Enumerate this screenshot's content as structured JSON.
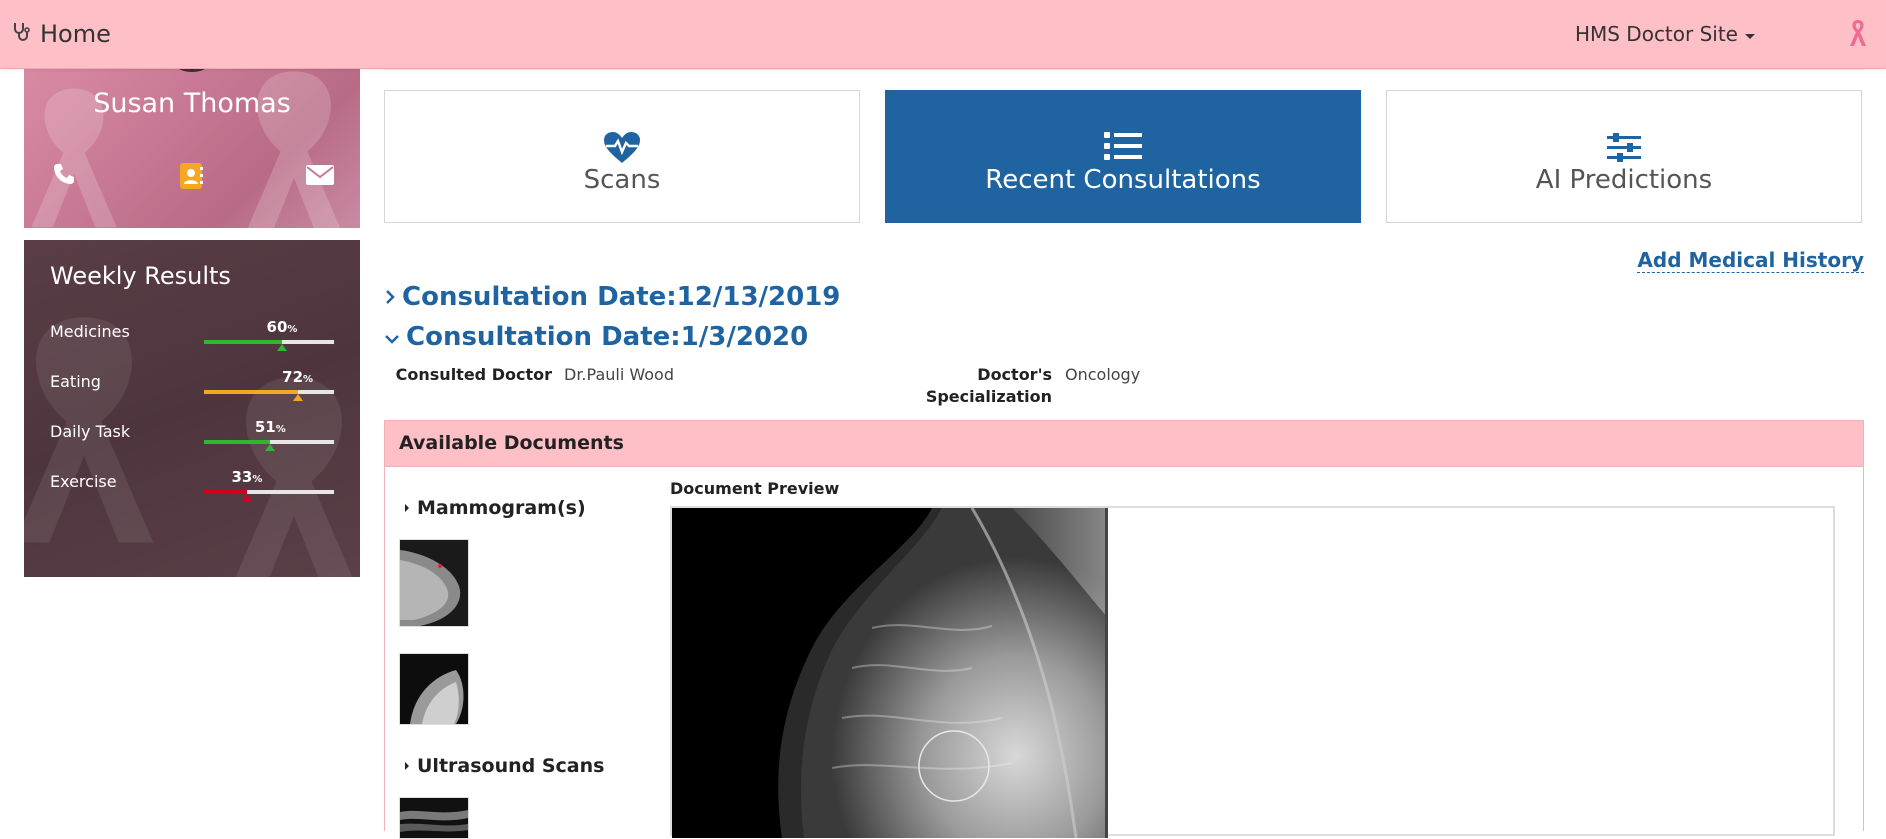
{
  "nav": {
    "home_label": "Home",
    "site_menu_label": "HMS Doctor Site",
    "icons": [
      "stethoscope-icon",
      "caret-down-icon",
      "pink-ribbon-icon"
    ]
  },
  "profile": {
    "name": "Susan Thomas",
    "icons": [
      "phone-icon",
      "contact-card-icon",
      "envelope-icon"
    ]
  },
  "weekly": {
    "title": "Weekly Results",
    "items": [
      {
        "label": "Medicines",
        "value": "60",
        "percent": 60,
        "color": "#2eb82e"
      },
      {
        "label": "Eating",
        "value": "72",
        "percent": 72,
        "color": "#f5a623"
      },
      {
        "label": "Daily Task",
        "value": "51",
        "percent": 51,
        "color": "#2eb82e"
      },
      {
        "label": "Exercise",
        "value": "33",
        "percent": 33,
        "color": "#d0021b"
      }
    ],
    "unit": "%"
  },
  "tabs": [
    {
      "label": "Scans",
      "icon": "heart-pulse-icon",
      "active": false
    },
    {
      "label": "Recent Consultations",
      "icon": "list-icon",
      "active": true
    },
    {
      "label": "AI Predictions",
      "icon": "sliders-icon",
      "active": false
    }
  ],
  "add_history_label": "Add Medical History",
  "consultations": [
    {
      "label": "Consultation Date:12/13/2019",
      "expanded": false
    },
    {
      "label": "Consultation Date:1/3/2020",
      "expanded": true
    }
  ],
  "details": {
    "doctor_label": "Consulted Doctor",
    "doctor_value": "Dr.Pauli Wood",
    "spec_label_line1": "Doctor's",
    "spec_label_line2": "Specialization",
    "spec_value": "Oncology"
  },
  "documents": {
    "title": "Available Documents",
    "groups": [
      "Mammogram(s)",
      "Ultrasound Scans"
    ],
    "preview_label": "Document Preview"
  },
  "colors": {
    "nav_bg": "#ffbfc6",
    "accent_blue": "#1f64a0",
    "weekly_bg": "#4e353d"
  }
}
